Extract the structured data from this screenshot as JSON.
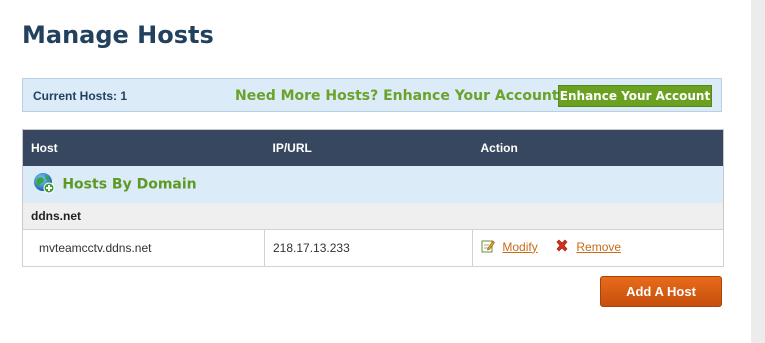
{
  "page": {
    "title": "Manage Hosts"
  },
  "promo": {
    "current_hosts_label": "Current Hosts:",
    "current_hosts_count": "1",
    "message": "Need More Hosts? Enhance Your Account!",
    "button_label": "Enhance Your Account"
  },
  "table": {
    "columns": [
      "Host",
      "IP/URL",
      "Action"
    ],
    "group": {
      "label": "Hosts By Domain",
      "icon": "globe-add-icon"
    },
    "domains": [
      {
        "name": "ddns.net",
        "hosts": [
          {
            "host": "mvteamcctv.ddns.net",
            "ip": "218.17.13.233",
            "modify_label": "Modify",
            "remove_label": "Remove"
          }
        ]
      }
    ]
  },
  "actions": {
    "add_host_label": "Add A Host"
  },
  "colors": {
    "title": "#22415f",
    "header_bg": "#36475f",
    "promo_bg": "#dcebf8",
    "green_accent": "#6aa121",
    "orange_accent": "#d75c10",
    "link": "#c96b18"
  }
}
